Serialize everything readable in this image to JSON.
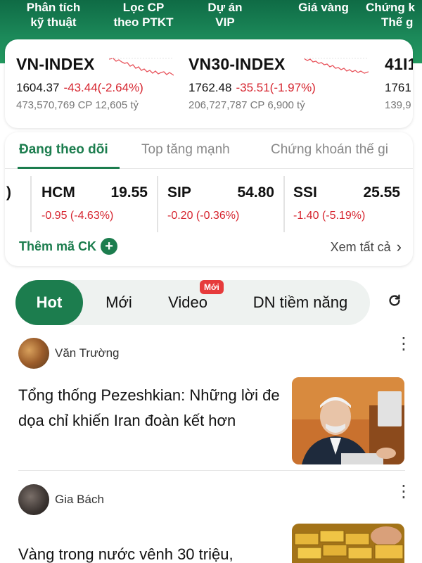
{
  "topnav": [
    {
      "line1": "Phân tích",
      "line2": "kỹ thuật"
    },
    {
      "line1": "Lọc CP",
      "line2": "theo PTKT"
    },
    {
      "line1": "Dự án",
      "line2": "VIP"
    },
    {
      "line1": "Giá vàng",
      "line2": ""
    },
    {
      "line1": "Chứng k",
      "line2": "Thế g"
    }
  ],
  "indices": [
    {
      "name": "VN-INDEX",
      "value": "1604.37",
      "change": "-43.44(-2.64%)",
      "volume": "473,570,769 CP 12,605 tỷ"
    },
    {
      "name": "VN30-INDEX",
      "value": "1762.48",
      "change": "-35.51(-1.97%)",
      "volume": "206,727,787 CP 6,900 tỷ"
    },
    {
      "name": "41I1",
      "value": "1761",
      "change": "",
      "volume": "139,9"
    }
  ],
  "watch": {
    "tabs": [
      "Đang theo dõi",
      "Top tăng mạnh",
      "Chứng khoán thế gi"
    ],
    "stocks": [
      {
        "symbol": ")",
        "price": "",
        "change": ""
      },
      {
        "symbol": "HCM",
        "price": "19.55",
        "change": "-0.95 (-4.63%)"
      },
      {
        "symbol": "SIP",
        "price": "54.80",
        "change": "-0.20 (-0.36%)"
      },
      {
        "symbol": "SSI",
        "price": "25.55",
        "change": "-1.40 (-5.19%)"
      }
    ],
    "add_label": "Thêm mã CK",
    "see_all_label": "Xem tất cả"
  },
  "filters": {
    "items": [
      "Hot",
      "Mới",
      "Video",
      "DN tiềm năng"
    ],
    "active": "Hot",
    "badge": "Mới"
  },
  "articles": [
    {
      "author": "Văn Trường",
      "title": "Tổng thống Pezeshkian: Những lời đe dọa chỉ khiến Iran đoàn kết hơn"
    },
    {
      "author": "Gia Bách",
      "title": "Vàng trong nước vênh 30 triệu,"
    }
  ],
  "colors": {
    "brand": "#1c7d4e",
    "down": "#d6252f"
  },
  "icons": {
    "add": "plus-circle-icon",
    "see_all": "chevron-right-icon",
    "refresh": "refresh-icon",
    "more": "more-vertical-icon"
  }
}
